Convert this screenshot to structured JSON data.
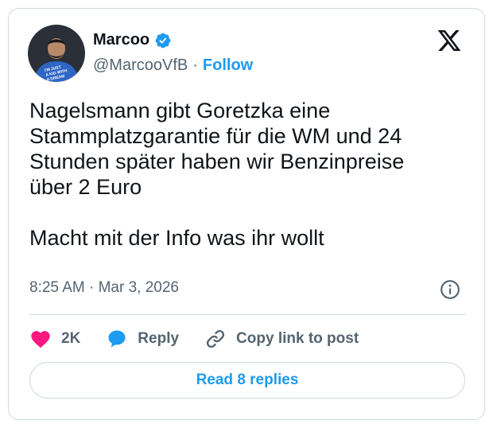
{
  "author": {
    "display_name": "Marcoo",
    "handle": "@MarcooVfB",
    "separator": "·",
    "follow_label": "Follow",
    "avatar_shirt_text": "I'M JUST A KID WITH A DREAM"
  },
  "tweet": {
    "text": "Nagelsmann gibt Goretzka eine\nStammplatzgarantie für die WM und 24\nStunden später haben wir Benzinpreise\nüber 2 Euro\n\nMacht mit der Info was ihr wollt",
    "timestamp": "8:25 AM · Mar 3, 2026"
  },
  "actions": {
    "like_count": "2K",
    "reply_label": "Reply",
    "copy_link_label": "Copy link to post"
  },
  "read_replies_label": "Read 8 replies",
  "icons": {
    "verified": "verified-badge-icon",
    "x_logo": "x-logo-icon",
    "info": "info-icon",
    "like": "heart-icon",
    "reply": "speech-bubble-icon",
    "copy_link": "link-icon"
  },
  "colors": {
    "accent": "#1d9bf0",
    "like": "#f91880",
    "text": "#0f1419",
    "muted": "#536471",
    "border": "#cfd9de"
  }
}
